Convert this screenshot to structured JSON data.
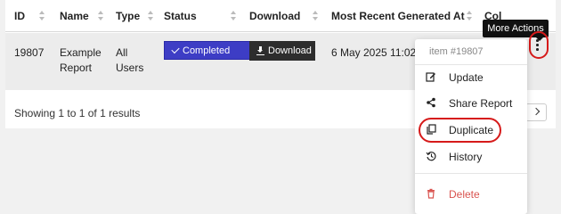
{
  "table": {
    "columns": [
      "ID",
      "Name",
      "Type",
      "Status",
      "Download",
      "Most Recent Generated At",
      "Col"
    ],
    "rows": [
      {
        "id": "19807",
        "name_line1": "Example",
        "name_line2": "Report",
        "type_line1": "All",
        "type_line2": "Users",
        "status": "Completed",
        "download": "Download",
        "generated_at": "6 May 2025 11:02"
      }
    ]
  },
  "footer": {
    "summary": "Showing 1 to 1 of 1 results"
  },
  "tooltip": {
    "text": "More Actions"
  },
  "actions_menu": {
    "header": "item #19807",
    "items": [
      {
        "label": "Update",
        "icon": "edit-icon"
      },
      {
        "label": "Share Report",
        "icon": "share-icon"
      },
      {
        "label": "Duplicate",
        "icon": "copy-icon"
      },
      {
        "label": "History",
        "icon": "history-icon"
      },
      {
        "label": "Delete",
        "icon": "trash-icon"
      }
    ]
  },
  "colors": {
    "status_completed": "#3d3dc5",
    "download_button": "#2d2d2d",
    "delete_text": "#d9534f",
    "highlight_ring": "#d61a1a"
  }
}
